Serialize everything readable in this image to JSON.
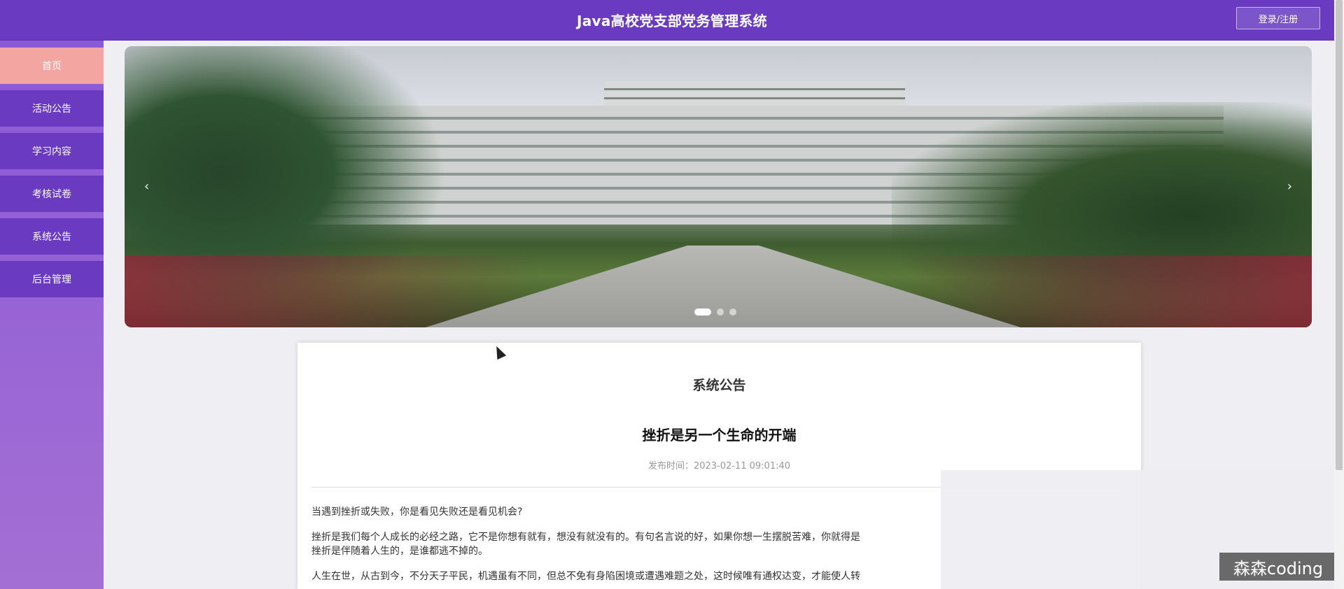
{
  "header": {
    "title": "Java高校党支部党务管理系统",
    "login_label": "登录/注册"
  },
  "sidebar": {
    "items": [
      {
        "label": "首页",
        "active": true
      },
      {
        "label": "活动公告"
      },
      {
        "label": "学习内容"
      },
      {
        "label": "考核试卷"
      },
      {
        "label": "系统公告"
      },
      {
        "label": "后台管理"
      }
    ]
  },
  "banner": {
    "prev_icon": "‹",
    "next_icon": "›",
    "slides": 3,
    "active_slide": 1
  },
  "notice": {
    "section_title": "系统公告",
    "article_title": "挫折是另一个生命的开端",
    "publish_time": "发布时间：2023-02-11 09:01:40",
    "paragraphs": [
      "当遇到挫折或失败，你是看见失败还是看见机会?",
      "挫折是我们每个人成长的必经之路，它不是你想有就有，想没有就没有的。有句名言说的好，如果你想一生摆脱苦难，你就得是",
      "挫折是伴随着人生的，是谁都逃不掉的。",
      "人生在世，从古到今，不分天子平民，机遇虽有不同，但总不免有身陷困境或遭遇难题之处，这时候唯有通权达变，才能使人转"
    ]
  },
  "watermark": "森森coding",
  "colors": {
    "header_bg": "#6a3bc1",
    "nav_bg": "#6a3bc1",
    "nav_active_bg": "#f2a5a1"
  }
}
